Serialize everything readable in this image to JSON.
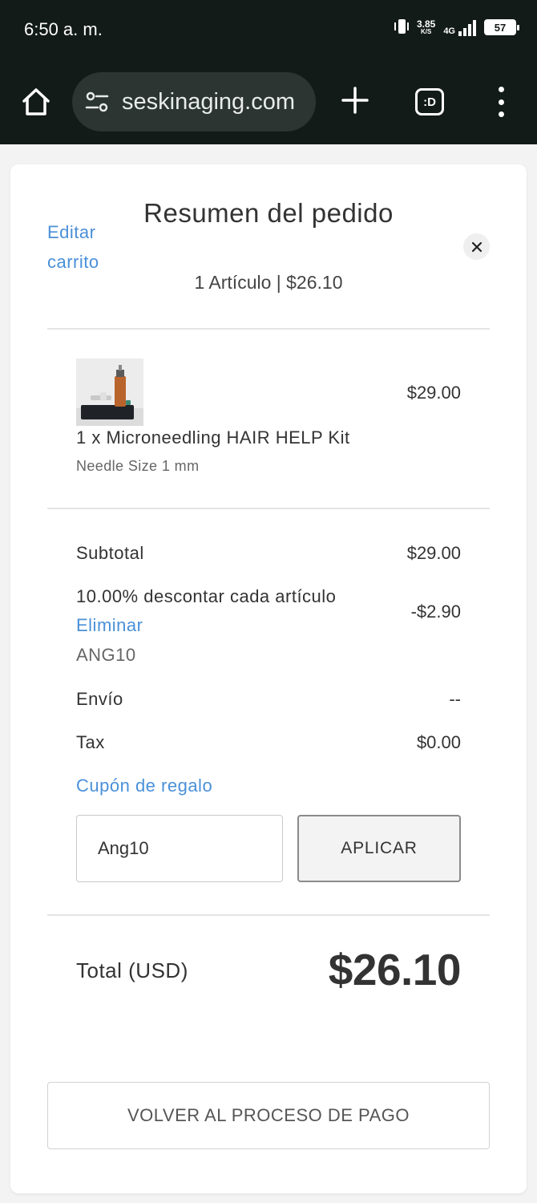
{
  "status_bar": {
    "time": "6:50 a. m.",
    "speed_value": "3.85",
    "speed_unit": "K/S",
    "network": "4G",
    "battery": "57"
  },
  "browser": {
    "url": "seskinaging.com",
    "tab_label": ":D",
    "icons": [
      "home-icon",
      "site-settings-icon",
      "new-tab-icon",
      "tab-switcher-icon",
      "more-menu-icon"
    ]
  },
  "order_summary": {
    "edit_cart": "Editar carrito",
    "title": "Resumen del pedido",
    "subtitle": "1 Artículo | $26.10",
    "product": {
      "name": "1 x Microneedling HAIR HELP Kit",
      "variant": "Needle Size 1 mm",
      "price": "$29.00"
    },
    "subtotal_label": "Subtotal",
    "subtotal_value": "$29.00",
    "discount_label": "10.00% descontar cada artículo",
    "discount_remove": "Eliminar",
    "discount_code": "ANG10",
    "discount_value": "-$2.90",
    "shipping_label": "Envío",
    "shipping_value": "--",
    "tax_label": "Tax",
    "tax_value": "$0.00",
    "gift_coupon_label": "Cupón de regalo",
    "coupon_input_value": "Ang10",
    "apply_button": "APLICAR",
    "total_label": "Total (USD)",
    "total_value": "$26.10",
    "back_button": "VOLVER AL PROCESO DE PAGO"
  },
  "colors": {
    "chrome_bg": "#121b17",
    "link": "#4a90d9",
    "text": "#333333"
  }
}
